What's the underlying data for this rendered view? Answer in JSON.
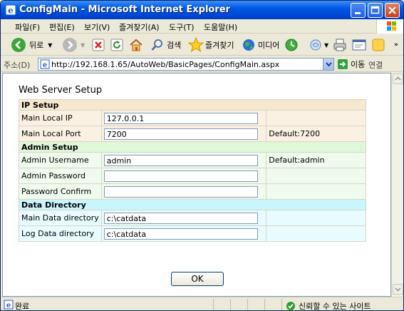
{
  "window": {
    "title": "ConfigMain - Microsoft Internet Explorer"
  },
  "menu": [
    "파일(F)",
    "편집(E)",
    "보기(V)",
    "즐겨찾기(A)",
    "도구(T)",
    "도움말(H)"
  ],
  "toolbar": {
    "back": "뒤로",
    "search": "검색",
    "favorites": "즐겨찾기",
    "media": "미디어"
  },
  "address": {
    "label": "주소(D)",
    "url": "http://192.168.1.65/AutoWeb/BasicPages/ConfigMain.aspx",
    "go": "이동",
    "links": "연결"
  },
  "page": {
    "title": "Web Server Setup",
    "ip_setup": {
      "header": "IP Setup",
      "main_ip_label": "Main Local IP",
      "main_ip_value": "127.0.0.1",
      "main_port_label": "Main Local Port",
      "main_port_value": "7200",
      "main_port_default": "Default:7200"
    },
    "admin_setup": {
      "header": "Admin Setup",
      "username_label": "Admin Username",
      "username_value": "admin",
      "username_default": "Default:admin",
      "password_label": "Admin Password",
      "password_value": "",
      "confirm_label": "Password Confirm",
      "confirm_value": ""
    },
    "data_directory": {
      "header": "Data Directory",
      "main_dir_label": "Main Data directory",
      "main_dir_value": "c:\\catdata",
      "log_dir_label": "Log Data directory",
      "log_dir_value": "c:\\catdata"
    },
    "ok_label": "OK"
  },
  "status": {
    "text": "완료",
    "zone": "신뢰할 수 있는 사이트"
  },
  "colors": {
    "ip_bg": "#fbf1e2",
    "admin_bg": "#effbec",
    "data_bg": "#e8fbff"
  }
}
